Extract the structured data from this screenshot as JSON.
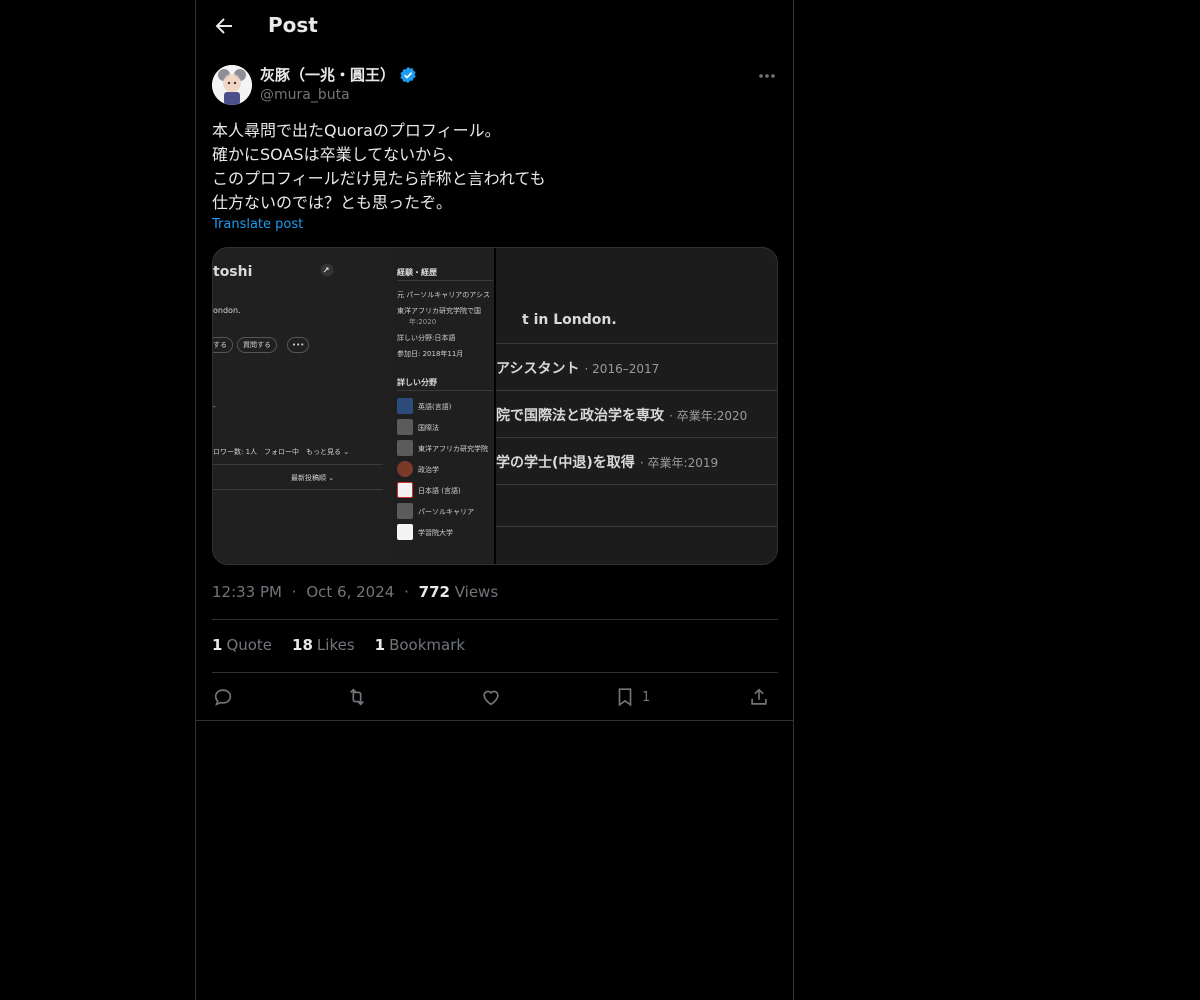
{
  "header": {
    "title": "Post"
  },
  "post": {
    "author_name": "灰豚（一兆・圓王）",
    "handle": "@mura_buta",
    "lines": [
      "本人尋問で出たQuoraのプロフィール。",
      "確かにSOASは卒業してないから、",
      "このプロフィールだけ見たら詐称と言われても",
      "仕方ないのでは？とも思ったぞ。"
    ],
    "translate_label": "Translate post",
    "time": "12:33 PM",
    "date": "Oct 6, 2024",
    "views_count": "772",
    "views_label": "Views",
    "quote_count": "1",
    "quote_label": "Quote",
    "likes_count": "18",
    "likes_label": "Likes",
    "bookmark_count": "1",
    "bookmark_label": "Bookmark",
    "bookmark_action_count": "1",
    "separator": "·"
  },
  "media": {
    "left": {
      "name_fragment": "toshi",
      "bio_fragment": "ondon.",
      "btn1": "する",
      "btn2": "質問する",
      "btn3": "•••",
      "dash": "-",
      "follow_row": "ロワー数: 1人　フォロー中　もっと見る ⌄",
      "sort": "最新投稿順 ⌄"
    },
    "mid": {
      "career_title": "経験・経歴",
      "career_items": [
        "元 パーソルキャリアのアシス",
        "東洋アフリカ研究学院で国",
        "年:2020",
        "詳しい分野:日本語",
        "参加日: 2018年11月"
      ],
      "topics_title": "詳しい分野",
      "topics": [
        "英語(言語)",
        "国際法",
        "東洋アフリカ研究学院",
        "政治学",
        "日本語 (言語)",
        "パーソルキャリア",
        "学習院大学"
      ]
    },
    "right": {
      "row1": "t in London.",
      "row2_main": "アシスタント",
      "row2_dim": "· 2016–2017",
      "row3_main": "院で国際法と政治学を専攻",
      "row3_dim": "· 卒業年:2020",
      "row4_main": "学の学士(中退)を取得",
      "row4_dim": "· 卒業年:2019"
    }
  },
  "colors": {
    "accent": "#1d9bf0",
    "muted": "#71767b",
    "text": "#e7e9ea",
    "border": "#2f3336"
  },
  "icons": [
    "back-arrow-icon",
    "verified-badge-icon",
    "more-icon",
    "reply-icon",
    "repost-icon",
    "like-icon",
    "bookmark-icon",
    "share-icon"
  ]
}
